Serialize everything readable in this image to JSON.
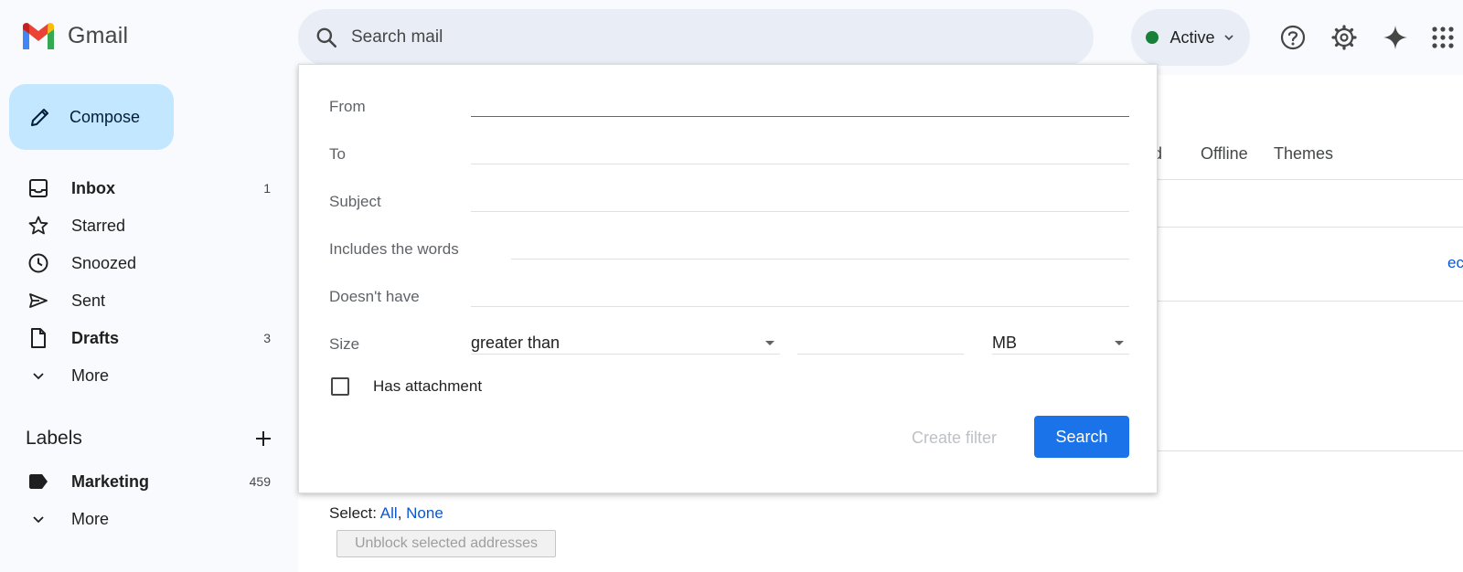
{
  "header": {
    "app_name": "Gmail",
    "search_placeholder": "Search mail",
    "status_label": "Active",
    "colors": {
      "status_dot": "#188038",
      "search_bg": "#e9eef6"
    }
  },
  "sidebar": {
    "compose_label": "Compose",
    "items": [
      {
        "label": "Inbox",
        "count": "1",
        "icon": "inbox-icon",
        "bold": true
      },
      {
        "label": "Starred",
        "count": "",
        "icon": "star-icon",
        "bold": false
      },
      {
        "label": "Snoozed",
        "count": "",
        "icon": "clock-icon",
        "bold": false
      },
      {
        "label": "Sent",
        "count": "",
        "icon": "send-icon",
        "bold": false
      },
      {
        "label": "Drafts",
        "count": "3",
        "icon": "draft-icon",
        "bold": true
      },
      {
        "label": "More",
        "count": "",
        "icon": "chevron-down-icon",
        "bold": false
      }
    ],
    "labels_heading": "Labels",
    "labels": [
      {
        "label": "Marketing",
        "count": "459",
        "icon": "label-icon",
        "bold": true
      },
      {
        "label": "More",
        "count": "",
        "icon": "chevron-down-icon",
        "bold": false
      }
    ]
  },
  "background": {
    "tabs": [
      "ced",
      "Offline",
      "Themes"
    ],
    "right_edge_link": "ec",
    "select_prefix": "Select:",
    "select_all": "All",
    "select_none": "None",
    "unblock_button": "Unblock selected addresses"
  },
  "advanced_search": {
    "from_label": "From",
    "to_label": "To",
    "subject_label": "Subject",
    "includes_label": "Includes the words",
    "doesnt_have_label": "Doesn't have",
    "size_label": "Size",
    "size_operator": "greater than",
    "size_unit": "MB",
    "has_attachment_label": "Has attachment",
    "create_filter_label": "Create filter",
    "search_button_label": "Search",
    "colors": {
      "search_button": "#1a73e8",
      "focus_line": "#1a73e8"
    }
  }
}
